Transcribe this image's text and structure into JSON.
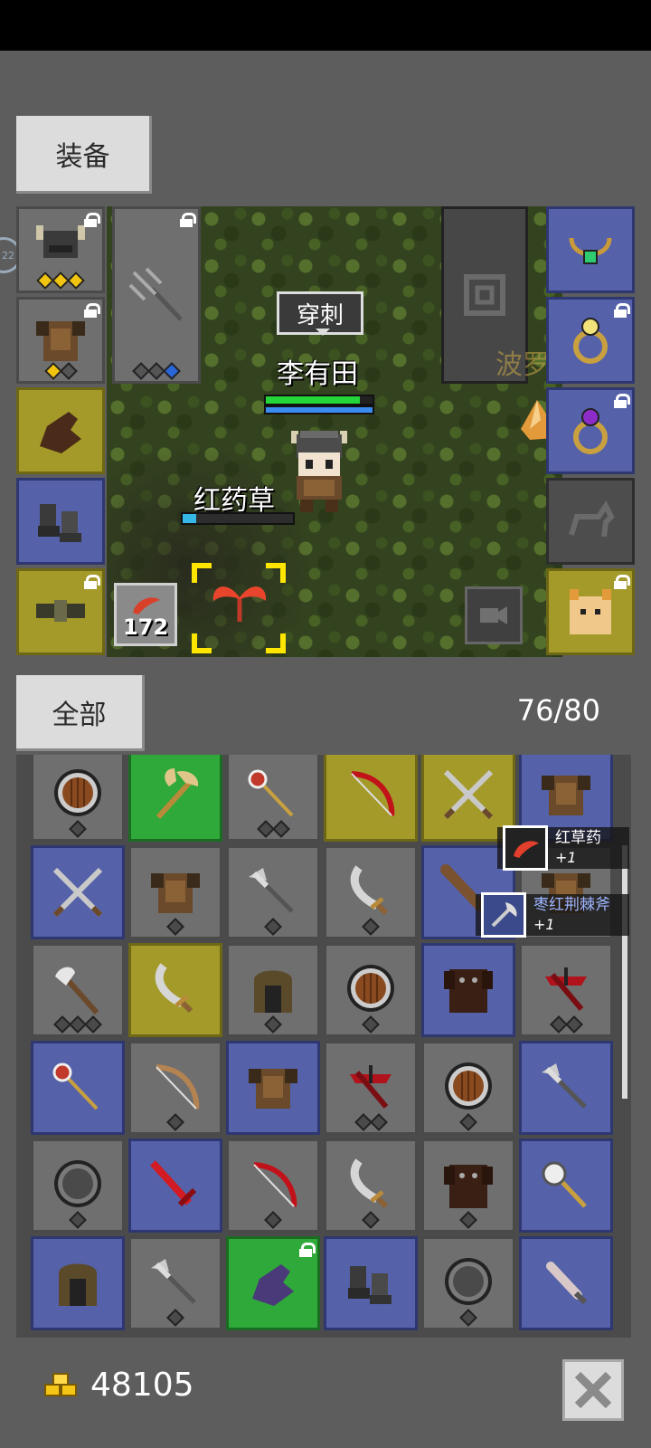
{
  "equip_tab_label": "装备",
  "all_tab_label": "全部",
  "inventory_count": "76/80",
  "side_badge": "22",
  "player": {
    "name": "李有田",
    "speech": "穿刺",
    "hp_fraction": 0.88,
    "mp_fraction": 1.0
  },
  "target": {
    "name": "红药草",
    "hp_fraction": 0.12
  },
  "ghost_name": "波罗",
  "quick_item_qty": "172",
  "pickups": [
    {
      "name": "红草药",
      "qty": "+1",
      "color": "#ffffff"
    },
    {
      "name": "枣红荆棘斧",
      "qty": "+1",
      "color": "#9db4ff"
    }
  ],
  "gold": "48105",
  "colors": {
    "hp": "#24d63a",
    "mp": "#3a8cf0",
    "target_hp": "#35b8e6",
    "target_frame": "#ffe600"
  },
  "equipment": {
    "left": [
      {
        "icon": "horned-helmet-icon",
        "rarity": "gray",
        "locked": true,
        "gems": [
          "gold",
          "gold",
          "gold"
        ]
      },
      {
        "icon": "leather-armor-icon",
        "rarity": "gray",
        "locked": true,
        "gems": [
          "gold",
          "gray"
        ]
      },
      {
        "icon": "leather-glove-icon",
        "rarity": "yellow",
        "locked": false,
        "gems": []
      },
      {
        "icon": "leather-boots-icon",
        "rarity": "blue",
        "locked": false,
        "gems": []
      },
      {
        "icon": "belt-icon",
        "rarity": "yellow",
        "locked": true,
        "gems": []
      }
    ],
    "weapon": {
      "icon": "trident-icon",
      "locked": true,
      "gems": [
        "gray",
        "gray",
        "blue"
      ]
    },
    "right": [
      {
        "icon": "emerald-necklace-icon",
        "rarity": "blue",
        "locked": false
      },
      {
        "icon": "topaz-ring-icon",
        "rarity": "blue",
        "locked": true
      },
      {
        "icon": "amethyst-ring-icon",
        "rarity": "blue",
        "locked": true
      },
      {
        "icon": "mount-slot-icon",
        "rarity": "dark",
        "locked": false
      },
      {
        "icon": "fox-pet-icon",
        "rarity": "yellow",
        "locked": true
      }
    ]
  },
  "inventory": [
    {
      "icon": "round-shield-icon",
      "rarity": "gray",
      "gems": 1
    },
    {
      "icon": "battle-axe-icon",
      "rarity": "green",
      "gems": 0
    },
    {
      "icon": "ruby-staff-icon",
      "rarity": "gray",
      "gems": 2
    },
    {
      "icon": "crimson-bow-icon",
      "rarity": "yellow",
      "gems": 0
    },
    {
      "icon": "crossed-swords-icon",
      "rarity": "yellow",
      "gems": 0
    },
    {
      "icon": "leather-armor-icon",
      "rarity": "blue",
      "gems": 0
    },
    {
      "icon": "crossed-swords-icon",
      "rarity": "blue",
      "gems": 0
    },
    {
      "icon": "leather-armor-icon",
      "rarity": "gray",
      "gems": 1
    },
    {
      "icon": "halberd-icon",
      "rarity": "gray",
      "gems": 1
    },
    {
      "icon": "scimitar-icon",
      "rarity": "gray",
      "gems": 1
    },
    {
      "icon": "wooden-club-icon",
      "rarity": "blue",
      "gems": 0
    },
    {
      "icon": "leather-armor-icon",
      "rarity": "gray",
      "gems": 0
    },
    {
      "icon": "hand-axe-icon",
      "rarity": "gray",
      "gems": 3
    },
    {
      "icon": "scimitar-icon",
      "rarity": "yellow",
      "gems": 0
    },
    {
      "icon": "leather-hood-icon",
      "rarity": "gray",
      "gems": 1
    },
    {
      "icon": "round-shield-icon",
      "rarity": "gray",
      "gems": 1
    },
    {
      "icon": "dark-armor-icon",
      "rarity": "blue",
      "gems": 0
    },
    {
      "icon": "crimson-crossbow-icon",
      "rarity": "gray",
      "gems": 2
    },
    {
      "icon": "ruby-staff-icon",
      "rarity": "blue",
      "gems": 0
    },
    {
      "icon": "wooden-bow-icon",
      "rarity": "gray",
      "gems": 1
    },
    {
      "icon": "leather-armor-icon",
      "rarity": "blue",
      "gems": 0
    },
    {
      "icon": "crimson-crossbow-icon",
      "rarity": "gray",
      "gems": 2
    },
    {
      "icon": "round-shield-icon",
      "rarity": "gray",
      "gems": 1
    },
    {
      "icon": "halberd-icon",
      "rarity": "blue",
      "gems": 0
    },
    {
      "icon": "steel-shield-icon",
      "rarity": "gray",
      "gems": 1
    },
    {
      "icon": "crimson-sword-icon",
      "rarity": "blue",
      "gems": 0
    },
    {
      "icon": "crimson-bow-icon",
      "rarity": "gray",
      "gems": 1
    },
    {
      "icon": "scimitar-icon",
      "rarity": "gray",
      "gems": 1
    },
    {
      "icon": "dark-armor-icon",
      "rarity": "gray",
      "gems": 1
    },
    {
      "icon": "mace-icon",
      "rarity": "blue",
      "gems": 0
    },
    {
      "icon": "leather-hood-icon",
      "rarity": "blue",
      "gems": 0
    },
    {
      "icon": "halberd-icon",
      "rarity": "gray",
      "gems": 1
    },
    {
      "icon": "purple-glove-icon",
      "rarity": "green",
      "gems": 0,
      "locked": true
    },
    {
      "icon": "leather-boots-icon",
      "rarity": "blue",
      "gems": 0
    },
    {
      "icon": "steel-shield-icon",
      "rarity": "gray",
      "gems": 1
    },
    {
      "icon": "dagger-icon",
      "rarity": "blue",
      "gems": 0
    }
  ]
}
